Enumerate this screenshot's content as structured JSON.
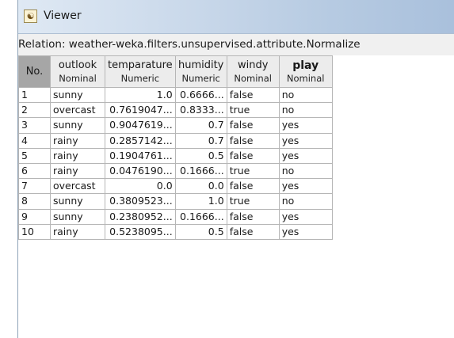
{
  "window": {
    "title": "Viewer",
    "icon": "weka-app-icon"
  },
  "relation_label": "Relation: weather-weka.filters.unsupervised.attribute.Normalize",
  "table": {
    "columns": [
      {
        "name": "No.",
        "type": ""
      },
      {
        "name": "outlook",
        "type": "Nominal"
      },
      {
        "name": "temparature",
        "type": "Numeric"
      },
      {
        "name": "humidity",
        "type": "Numeric"
      },
      {
        "name": "windy",
        "type": "Nominal"
      },
      {
        "name": "play",
        "type": "Nominal"
      }
    ],
    "rows": [
      [
        "1",
        "sunny",
        "1.0",
        "0.6666...",
        "false",
        "no"
      ],
      [
        "2",
        "overcast",
        "0.7619047...",
        "0.8333...",
        "true",
        "no"
      ],
      [
        "3",
        "sunny",
        "0.9047619...",
        "0.7",
        "false",
        "yes"
      ],
      [
        "4",
        "rainy",
        "0.2857142...",
        "0.7",
        "false",
        "yes"
      ],
      [
        "5",
        "rainy",
        "0.1904761...",
        "0.5",
        "false",
        "yes"
      ],
      [
        "6",
        "rainy",
        "0.0476190...",
        "0.1666...",
        "true",
        "no"
      ],
      [
        "7",
        "overcast",
        "0.0",
        "0.0",
        "false",
        "yes"
      ],
      [
        "8",
        "sunny",
        "0.3809523...",
        "1.0",
        "true",
        "no"
      ],
      [
        "9",
        "sunny",
        "0.2380952...",
        "0.1666...",
        "false",
        "yes"
      ],
      [
        "10",
        "rainy",
        "0.5238095...",
        "0.5",
        "false",
        "yes"
      ]
    ]
  }
}
